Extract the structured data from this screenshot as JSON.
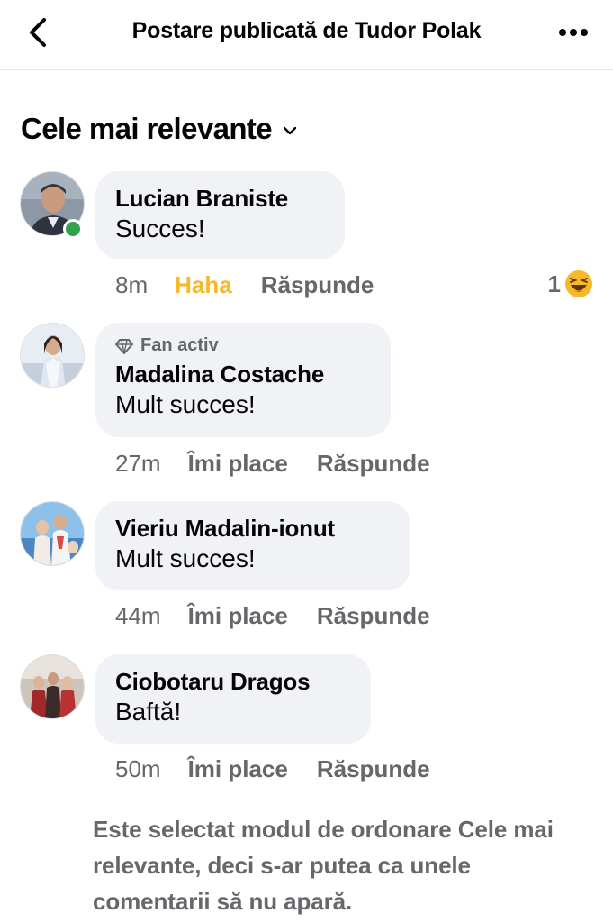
{
  "header": {
    "title": "Postare publicată de Tudor Polak",
    "back_icon": "chevron-left-icon",
    "more_icon": "more-dots-icon"
  },
  "sort": {
    "label": "Cele mai relevante",
    "icon": "chevron-down-icon"
  },
  "comments": [
    {
      "author": "Lucian Braniste",
      "text": "Succes!",
      "time": "8m",
      "reaction_label": "Haha",
      "reply_label": "Răspunde",
      "reaction_count": "1",
      "reaction_icon": "haha-emoji-icon",
      "online": true,
      "avatar_colors": [
        "#7a8a9a",
        "#3b3f46"
      ]
    },
    {
      "badge": "Fan activ",
      "badge_icon": "diamond-icon",
      "author": "Madalina Costache",
      "text": "Mult succes!",
      "time": "27m",
      "like_label": "Îmi place",
      "reply_label": "Răspunde",
      "avatar_colors": [
        "#c9d6e8",
        "#2a2a2a"
      ]
    },
    {
      "author": "Vieriu Madalin-ionut",
      "text": "Mult succes!",
      "time": "44m",
      "like_label": "Îmi place",
      "reply_label": "Răspunde",
      "avatar_colors": [
        "#7fb6e6",
        "#e8d5c4"
      ]
    },
    {
      "author": "Ciobotaru Dragos",
      "text": "Baftă!",
      "time": "50m",
      "like_label": "Îmi place",
      "reply_label": "Răspunde",
      "avatar_colors": [
        "#8b2b2b",
        "#d8b49a"
      ]
    }
  ],
  "footer_note": "Este selectat modul de ordonare Cele mai relevante, deci s-ar putea ca unele comentarii să nu apară.",
  "colors": {
    "haha_accent": "#f7b928",
    "online": "#31a24c",
    "bubble_bg": "#f0f2f5",
    "secondary_text": "#65676b"
  }
}
